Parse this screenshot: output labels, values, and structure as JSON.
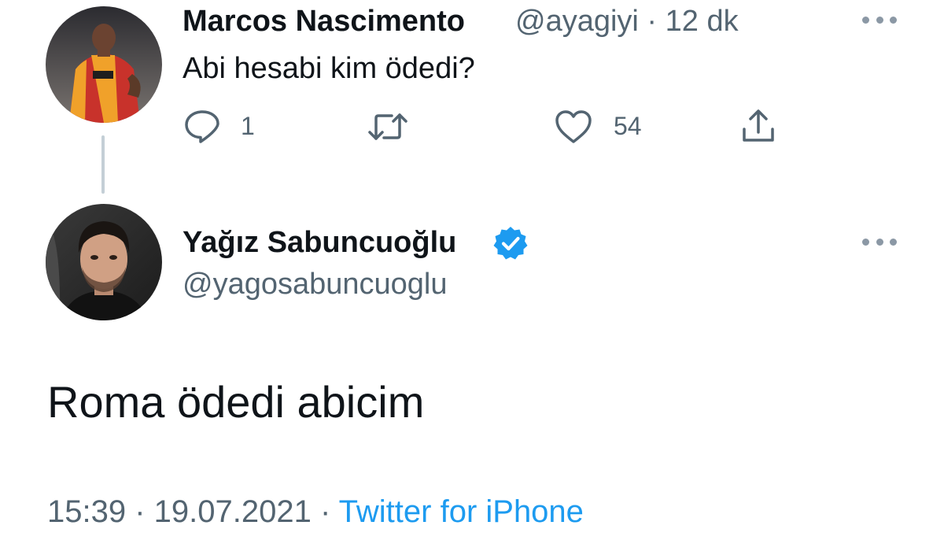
{
  "reply_tweet": {
    "display_name": "Marcos Nascimento",
    "meta": "@ayagiyi · 12 dk",
    "text": "Abi hesabi kim ödedi?",
    "actions": {
      "reply_count": "1",
      "like_count": "54"
    },
    "icons": [
      "reply-icon",
      "retweet-icon",
      "like-icon",
      "share-icon",
      "more-icon"
    ]
  },
  "main_tweet": {
    "display_name": "Yağız Sabuncuoğlu",
    "handle": "@yagosabuncuoglu",
    "text": "Roma ödedi abicim",
    "footer": {
      "time_date": "15:39 · 19.07.2021 · ",
      "source": "Twitter for iPhone"
    }
  },
  "colors": {
    "text": "#0f1419",
    "secondary": "#536471",
    "link": "#1d9bf0",
    "verified": "#1d9bf0",
    "thread_line": "#c4cfd6"
  }
}
